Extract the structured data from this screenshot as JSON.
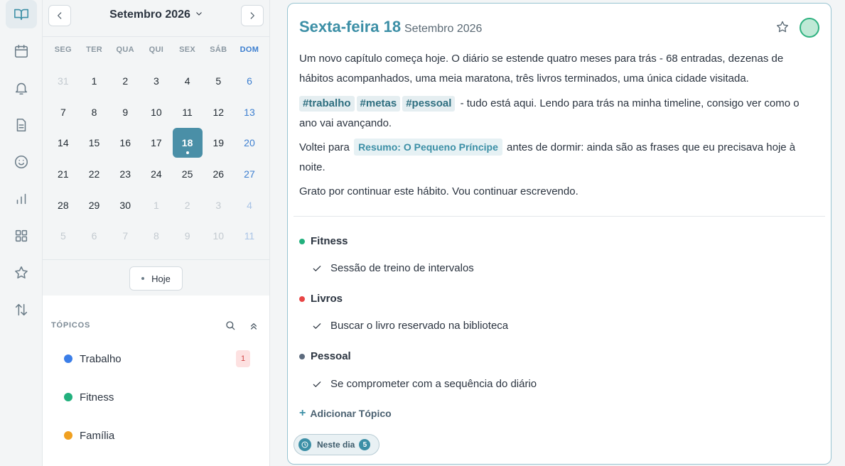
{
  "rail": {
    "items": [
      {
        "icon": "book-open-icon",
        "active": true
      },
      {
        "icon": "calendar-icon"
      },
      {
        "icon": "bell-icon"
      },
      {
        "icon": "document-icon"
      },
      {
        "icon": "smiley-icon"
      },
      {
        "icon": "bar-chart-icon"
      },
      {
        "icon": "grid-icon"
      },
      {
        "icon": "star-icon"
      },
      {
        "icon": "sort-arrows-icon"
      }
    ]
  },
  "calendar": {
    "month_label": "Setembro 2026",
    "weekdays": [
      "SEG",
      "TER",
      "QUA",
      "QUI",
      "SEX",
      "SÁB",
      "DOM"
    ],
    "weeks": [
      [
        "31",
        "1",
        "2",
        "3",
        "4",
        "5",
        "6"
      ],
      [
        "7",
        "8",
        "9",
        "10",
        "11",
        "12",
        "13"
      ],
      [
        "14",
        "15",
        "16",
        "17",
        "18",
        "19",
        "20"
      ],
      [
        "21",
        "22",
        "23",
        "24",
        "25",
        "26",
        "27"
      ],
      [
        "28",
        "29",
        "30",
        "1",
        "2",
        "3",
        "4"
      ],
      [
        "5",
        "6",
        "7",
        "8",
        "9",
        "10",
        "11"
      ]
    ],
    "selected_day": "18",
    "today_label": "Hoje"
  },
  "topics": {
    "heading": "TÓPICOS",
    "items": [
      {
        "label": "Trabalho",
        "color": "#3b7ee8",
        "badge": "1"
      },
      {
        "label": "Fitness",
        "color": "#22b07d"
      },
      {
        "label": "Família",
        "color": "#f0a020"
      }
    ]
  },
  "entry": {
    "title": "Sexta-feira 18",
    "subtitle": "Setembro 2026",
    "mood_color": "#bfe9d6",
    "para1": "Um novo capítulo começa hoje. O diário se estende quatro meses para trás - 68 entradas, dezenas de hábitos acompanhados, uma meia maratona, três livros terminados, uma única cidade visitada.",
    "tags": [
      "#trabalho",
      "#metas",
      "#pessoal"
    ],
    "para2_rest": " - tudo está aqui. Lendo para trás na minha timeline, consigo ver como o ano vai avançando.",
    "para3_pre": "Voltei para ",
    "para3_link": "Resumo: O Pequeno Príncipe",
    "para3_post": " antes de dormir: ainda são as frases que eu precisava hoje à noite.",
    "para4": "Grato por continuar este hábito. Vou continuar escrevendo.",
    "sections": [
      {
        "name": "Fitness",
        "color": "#22b07d",
        "task": "Sessão de treino de intervalos"
      },
      {
        "name": "Livros",
        "color": "#e84545",
        "task": "Buscar o livro reservado na biblioteca"
      },
      {
        "name": "Pessoal",
        "color": "#5d6b7e",
        "task": "Se comprometer com a sequência do diário"
      }
    ],
    "add_topic_label": "Adicionar Tópico",
    "on_this_day_label": "Neste dia",
    "on_this_day_count": "5"
  }
}
